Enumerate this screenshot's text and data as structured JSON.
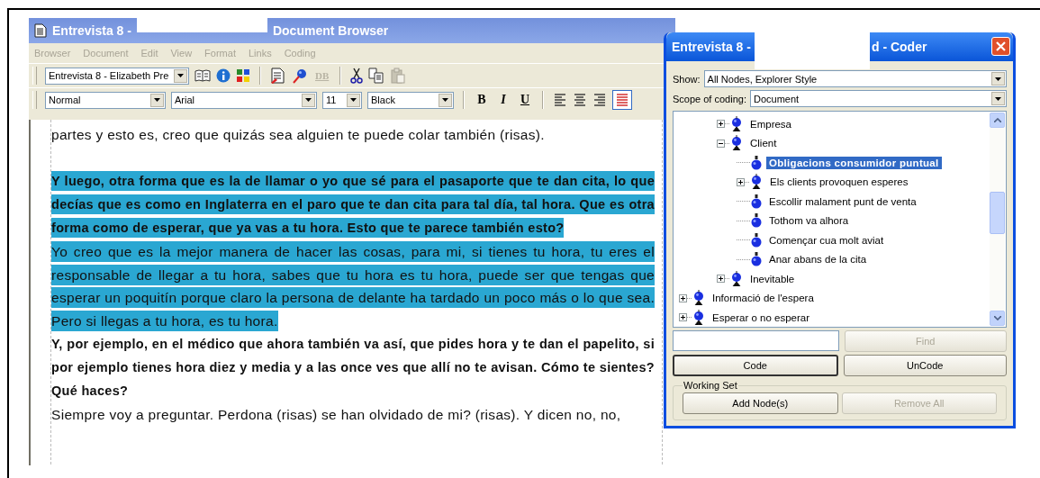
{
  "browser": {
    "title_parts": [
      "Entrevista 8 -",
      "Document Browser"
    ],
    "active": false,
    "menu": [
      "Browser",
      "Document",
      "Edit",
      "View",
      "Format",
      "Links",
      "Coding"
    ],
    "toolbar": {
      "document": "Entrevista 8 - Elizabeth Pre",
      "db_label": "DB",
      "db_disabled": true,
      "paste_disabled": true
    },
    "format_bar": {
      "style": "Normal",
      "font": "Arial",
      "size": "11",
      "font_color_select": "Black",
      "bold_label": "B",
      "italic_label": "I",
      "underline_label": "U",
      "justify_pressed": true
    },
    "paragraphs": [
      {
        "text": "partes y esto es, creo que quizás sea alguien te puede colar también (risas).",
        "bold": false,
        "highlighted": false
      },
      {
        "text": "Y luego, otra forma que es la de llamar o yo que sé para el pasaporte que te dan cita, lo que decías que es como en Inglaterra en el paro que te dan cita para tal día, tal hora. Que es otra forma como de esperar, que ya vas a tu hora. Esto que te parece también esto?",
        "bold": true,
        "highlighted": true
      },
      {
        "text": "Yo creo que es la mejor manera de hacer las cosas, para mi, si tienes tu hora, tu eres el responsable de llegar a tu hora, sabes que tu hora es tu hora, puede ser que tengas que esperar un poquitín porque claro la persona de delante ha tardado un poco más o lo que sea. Pero si llegas a tu hora, es tu hora.",
        "bold": false,
        "highlighted": true
      },
      {
        "text": "Y, por ejemplo, en el médico que ahora también va así, que pides hora y te dan el papelito, si por ejemplo tienes hora diez y media y a las once ves que allí no te avisan. Cómo te sientes? Qué haces?",
        "bold": true,
        "highlighted": false
      },
      {
        "text": "Siempre voy a preguntar. Perdona (risas) se han olvidado de mi? (risas). Y dicen no, no,",
        "bold": false,
        "highlighted": false
      }
    ]
  },
  "coder": {
    "title_parts": [
      "Entrevista 8 -",
      "d - Coder"
    ],
    "active": true,
    "show_label": "Show:",
    "show_value": "All Nodes, Explorer Style",
    "scope_label": "Scope of coding:",
    "scope_value": "Document",
    "tree": {
      "hidden_parent_children": [
        {
          "label": "Empresa",
          "expanded": false,
          "selected": false
        },
        {
          "label": "Client",
          "expanded": true,
          "selected": false,
          "children": [
            {
              "label": "Obligacions consumidor puntual",
              "selected": true
            },
            {
              "label": "Els clients provoquen esperes",
              "expanded": false,
              "selected": false
            },
            {
              "label": "Escollir malament punt de venta",
              "selected": false
            },
            {
              "label": "Tothom va alhora",
              "selected": false
            },
            {
              "label": "Començar cua molt aviat",
              "selected": false
            },
            {
              "label": "Anar abans de la cita",
              "selected": false
            }
          ]
        },
        {
          "label": "Inevitable",
          "expanded": false,
          "selected": false
        }
      ],
      "items": [
        {
          "label": "Informació de l'espera",
          "expanded": false,
          "selected": false
        },
        {
          "label": "Esperar o no esperar",
          "expanded": false,
          "selected": false
        }
      ]
    },
    "find_button": {
      "label": "Find",
      "disabled": true
    },
    "code_button": {
      "label": "Code",
      "default": true
    },
    "uncode_button": {
      "label": "UnCode",
      "disabled": false
    },
    "working_set": {
      "label": "Working Set",
      "add_button": {
        "label": "Add Node(s)",
        "disabled": false
      },
      "remove_button": {
        "label": "Remove All",
        "disabled": true
      }
    }
  }
}
